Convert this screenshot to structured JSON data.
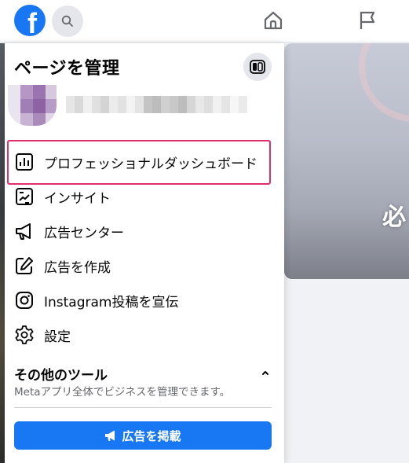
{
  "topbar": {
    "logo_letter": "f",
    "icons": [
      "facebook-logo",
      "search-icon",
      "home-icon",
      "flag-icon"
    ]
  },
  "panel": {
    "title": "ページを管理",
    "menu": [
      {
        "label": "プロフェッショナルダッシュボード",
        "icon": "dashboard-icon",
        "highlighted": true
      },
      {
        "label": "インサイト",
        "icon": "insights-icon"
      },
      {
        "label": "広告センター",
        "icon": "megaphone-icon"
      },
      {
        "label": "広告を作成",
        "icon": "edit-icon"
      },
      {
        "label": "Instagram投稿を宣伝",
        "icon": "instagram-icon"
      },
      {
        "label": "設定",
        "icon": "gear-icon"
      }
    ],
    "tools": {
      "title": "その他のツール",
      "description": "Metaアプリ全体でビジネスを管理できます。"
    },
    "promote_button": "広告を掲載"
  },
  "cover": {
    "overlay_char": "必"
  },
  "colors": {
    "brand": "#1877f2",
    "highlight": "#e0306a"
  }
}
